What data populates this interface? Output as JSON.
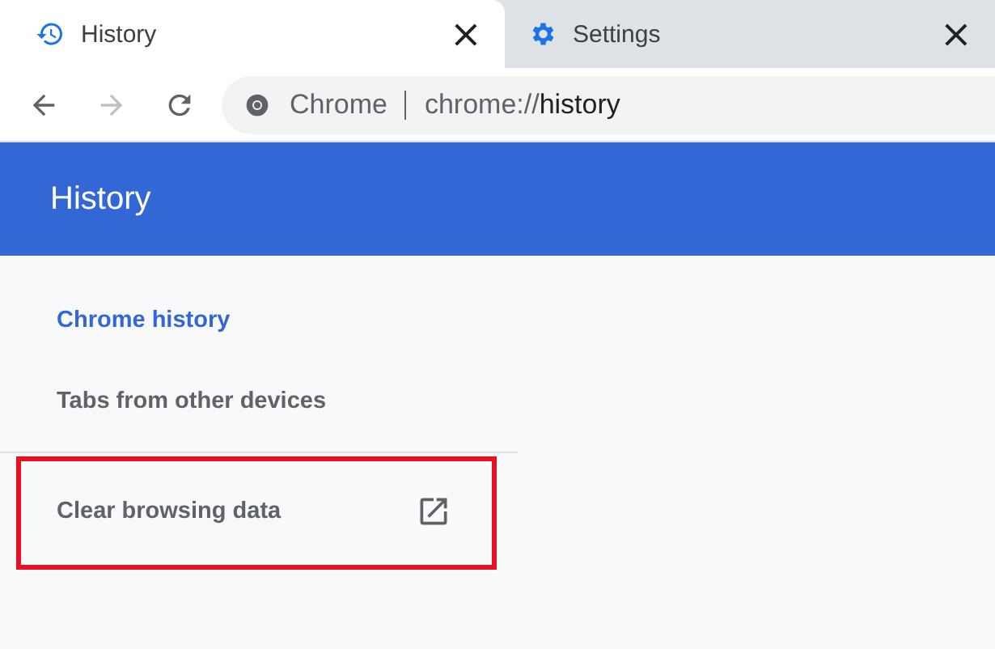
{
  "tabs": [
    {
      "label": "History",
      "kind": "history",
      "selected": true,
      "close": "×"
    },
    {
      "label": "Settings",
      "kind": "settings",
      "selected": false,
      "close": "×"
    }
  ],
  "toolbar": {
    "back_disabled": false,
    "forward_disabled": true,
    "site_label": "Chrome",
    "url": {
      "prefix": "chrome://",
      "path": "history"
    }
  },
  "header": {
    "title": "History"
  },
  "sidebar": {
    "items": [
      {
        "label": "Chrome history",
        "selected": true,
        "external": false,
        "highlighted": false
      },
      {
        "label": "Tabs from other devices",
        "selected": false,
        "external": false,
        "highlighted": false
      }
    ],
    "footer_items": [
      {
        "label": "Clear browsing data",
        "selected": false,
        "external": true,
        "highlighted": true
      }
    ]
  }
}
